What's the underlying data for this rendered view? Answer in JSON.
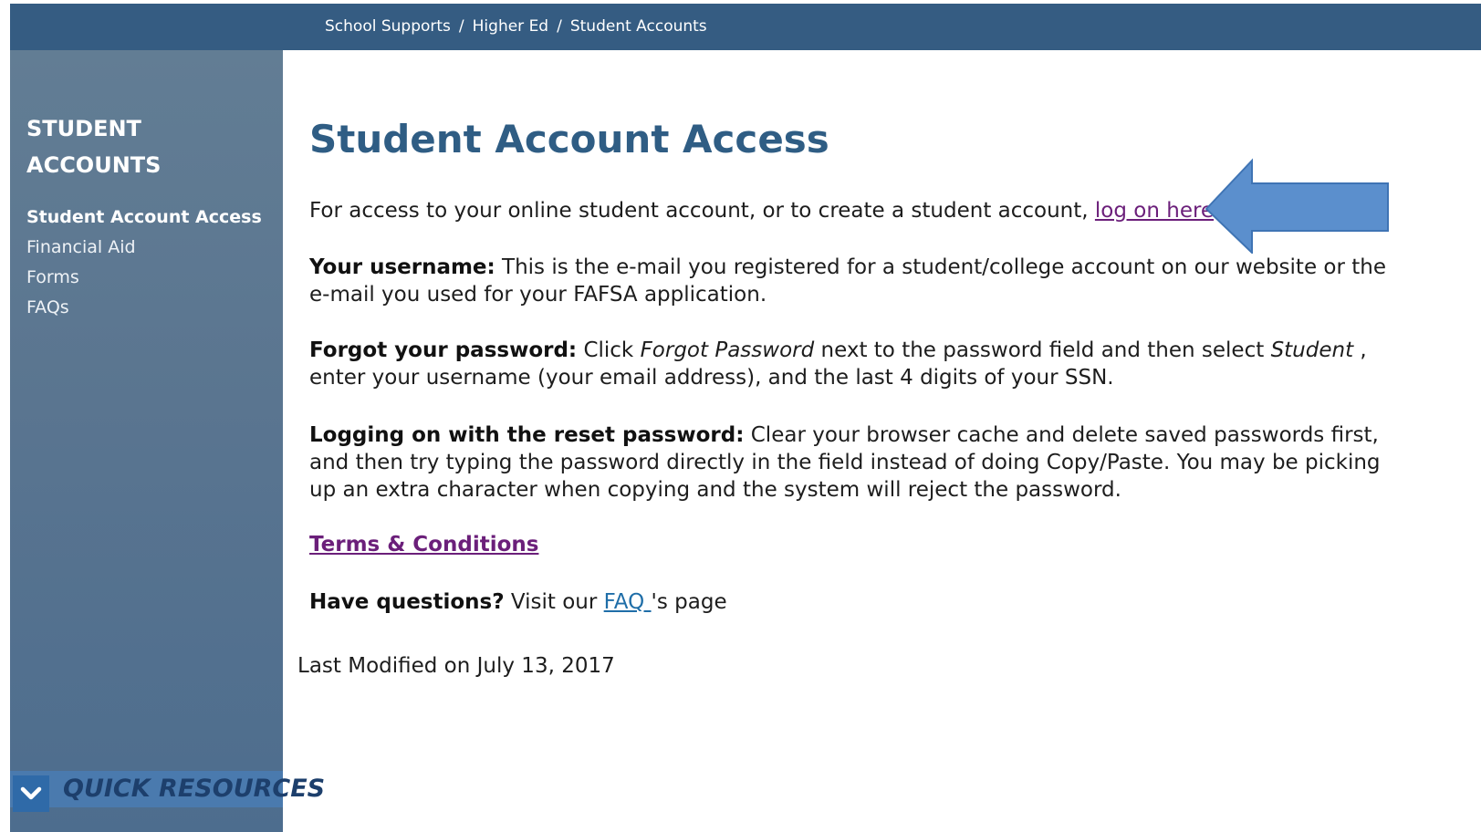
{
  "breadcrumb": [
    "School Supports",
    "Higher Ed",
    "Student Accounts"
  ],
  "sidebar": {
    "title_line1": "STUDENT",
    "title_line2": "ACCOUNTS",
    "items": [
      {
        "label": "Student Account Access"
      },
      {
        "label": "Financial Aid"
      },
      {
        "label": "Forms"
      },
      {
        "label": "FAQs"
      }
    ],
    "quick_resources": "QUICK RESOURCES"
  },
  "main": {
    "title": "Student Account Access",
    "intro_text": "For access to your online student account, or to create a student account, ",
    "intro_link": "log on here",
    "username_label": "Your username:",
    "username_text": " This is the e-mail you registered for a student/college account on our website or the e-mail you used for your FAFSA application.",
    "forgot_label": "Forgot your password:",
    "forgot_t1": " Click ",
    "forgot_em1": "Forgot Password",
    "forgot_t2": " next to the password field and then select ",
    "forgot_em2": "Student",
    "forgot_t3": " , enter your username (your email address), and the last 4 digits of your SSN.",
    "reset_label": "Logging on with the reset password:",
    "reset_text": " Clear your browser cache and delete saved passwords first, and then try typing the password directly in the field instead of doing Copy/Paste. You may be picking up an extra character when copying and the system will reject the password.",
    "terms_link": "Terms & Conditions",
    "questions_label": "Have questions?",
    "questions_text": " Visit our ",
    "faq_link": "FAQ ",
    "questions_suffix": "'s page",
    "last_modified": "Last Modified on July 13, 2017"
  },
  "colors": {
    "topbar": "#355c82",
    "sidebar": "#5a7590",
    "title": "#2f5d84",
    "visited_link": "#6b1f7a",
    "link": "#1f6ea8",
    "arrow": "#5b8fcd"
  },
  "icons": {
    "quick_resources": "chevron-down-icon",
    "annotation": "left-arrow-icon"
  }
}
